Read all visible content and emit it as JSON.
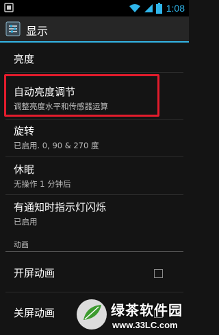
{
  "status_bar": {
    "time": "1:08",
    "icons": [
      "android-debug-icon",
      "wifi-icon",
      "signal-icon",
      "battery-icon"
    ],
    "accent": "#2fb5ea"
  },
  "action_bar": {
    "title": "显示",
    "icon": "settings-icon"
  },
  "items": [
    {
      "title": "亮度"
    },
    {
      "title": "自动亮度调节",
      "subtitle": "调整亮度水平和传感器运算"
    },
    {
      "title": "旋转",
      "subtitle": "已启用. 0, 90 & 270 度"
    },
    {
      "title": "休眠",
      "subtitle": "无操作 1 分钟后"
    },
    {
      "title": "有通知时指示灯闪烁",
      "subtitle": "已启用"
    }
  ],
  "section": {
    "label": "动画"
  },
  "animation_items": [
    {
      "title": "开屏动画",
      "checked": false
    },
    {
      "title": "关屏动画",
      "checked": false
    }
  ],
  "highlight_color": "#e21c2c",
  "watermark": {
    "name": "绿茶软件园",
    "url": "www.33LC.com"
  }
}
